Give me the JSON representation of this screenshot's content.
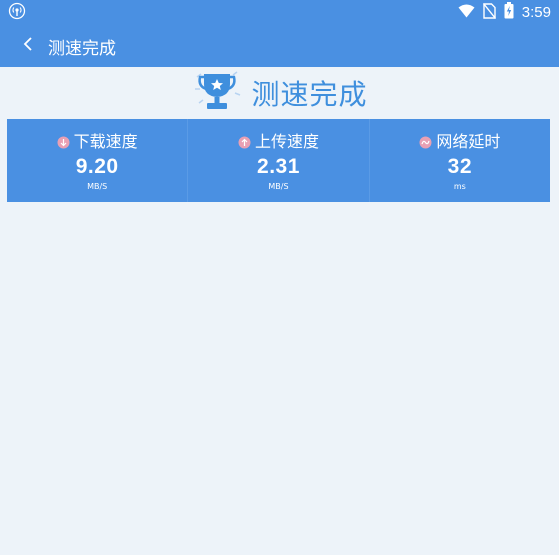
{
  "status_bar": {
    "time": "3:59",
    "icons": [
      "signal-broadcast-icon",
      "wifi-icon",
      "no-sim-icon",
      "battery-charging-icon"
    ]
  },
  "header": {
    "title": "测速完成",
    "back_icon": "chevron-left-icon"
  },
  "banner": {
    "icon": "trophy-icon",
    "text": "测速完成"
  },
  "stats": [
    {
      "label": "下载速度",
      "value": "9.20",
      "unit": "MB/S",
      "icon": "download-arrow-icon"
    },
    {
      "label": "上传速度",
      "value": "2.31",
      "unit": "MB/S",
      "icon": "upload-arrow-icon"
    },
    {
      "label": "网络延时",
      "value": "32",
      "unit": "ms",
      "icon": "latency-icon"
    }
  ],
  "colors": {
    "primary": "#4a90e2",
    "background": "#edf3f9",
    "banner_text": "#3f8fdd",
    "stat_icon": "#e8a0b4"
  }
}
